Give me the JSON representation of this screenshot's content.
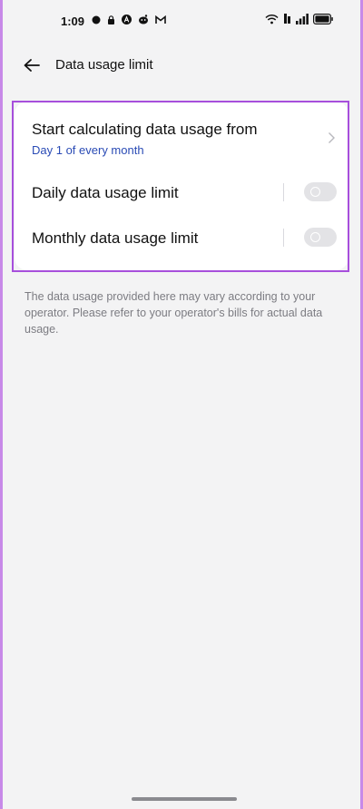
{
  "status_bar": {
    "time": "1:09",
    "notification_icons": [
      "chat-bubble-icon",
      "lock-app-icon",
      "a-logo-icon",
      "reddit-icon",
      "gmail-icon"
    ],
    "system_icons": [
      "wifi-icon",
      "signal-icon",
      "signal-bars-icon",
      "battery-icon"
    ]
  },
  "header": {
    "title": "Data usage limit"
  },
  "settings": {
    "calc_start": {
      "label": "Start calculating data usage from",
      "value": "Day 1 of every month"
    },
    "daily_limit": {
      "label": "Daily data usage limit",
      "enabled": false
    },
    "monthly_limit": {
      "label": "Monthly data usage limit",
      "enabled": false
    }
  },
  "note": "The data usage provided here may vary according to your operator. Please refer to your operator's bills for actual data usage.",
  "colors": {
    "background": "#f3f3f4",
    "card": "#ffffff",
    "accent_link": "#2a4bb5",
    "highlight_border": "#a74fdc",
    "toggle_off": "#e3e3e6"
  }
}
